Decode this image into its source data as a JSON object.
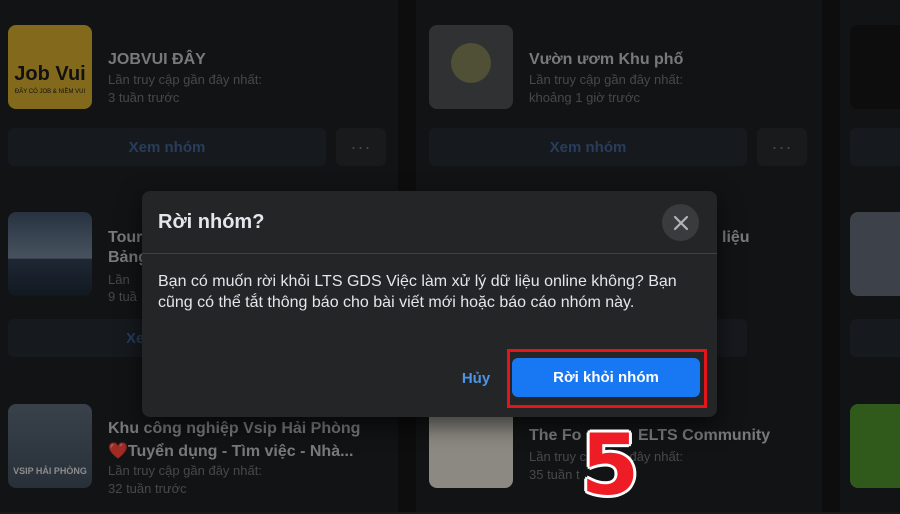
{
  "groups": [
    {
      "name": "JOBVUI ĐÂY",
      "last_visit_label": "Lần truy cập gần đây nhất:",
      "last_visit_time": "3 tuần trước",
      "thumb_text": "Job Vui",
      "thumb_caption": "ĐÂY CÓ JOB & NIỀM VUI"
    },
    {
      "name": "Vườn ươm Khu phố",
      "last_visit_label": "Lần truy cập gần đây nhất:",
      "last_visit_time": "khoảng 1 giờ trước"
    },
    {
      "name": "Tour",
      "name_line2": "Bảng",
      "last_visit_label": "Lần",
      "last_visit_time": "9 tuầ"
    },
    {
      "name": "liệu"
    },
    {
      "name": "Khu công nghiệp Vsip Hải Phòng",
      "name_line2": "❤️Tuyển dụng - Tìm việc - Nhà...",
      "last_visit_label": "Lần truy cập gần đây nhất:",
      "last_visit_time": "32 tuần trước",
      "thumb_text": "VSIP HẢI PHÒNG"
    },
    {
      "name": "The Fo",
      "name_tail": "ELTS Community",
      "last_visit_label": "Lần truy cập gần đây nhất:",
      "last_visit_time": "35 tuần t"
    }
  ],
  "view_group_label": "Xem nhóm",
  "more_label": "···",
  "partial_left_button": "Xe",
  "dialog": {
    "title": "Rời nhóm?",
    "body": "Bạn có muốn rời khỏi LTS GDS Việc làm xử lý dữ liệu online không? Bạn cũng có thể tắt thông báo cho bài viết mới hoặc báo cáo nhóm này.",
    "cancel_label": "Hủy",
    "confirm_label": "Rời khỏi nhóm"
  },
  "step_number": "5",
  "colors": {
    "primary": "#1877f2",
    "highlight": "#e3151a",
    "link": "#4b95e6"
  }
}
